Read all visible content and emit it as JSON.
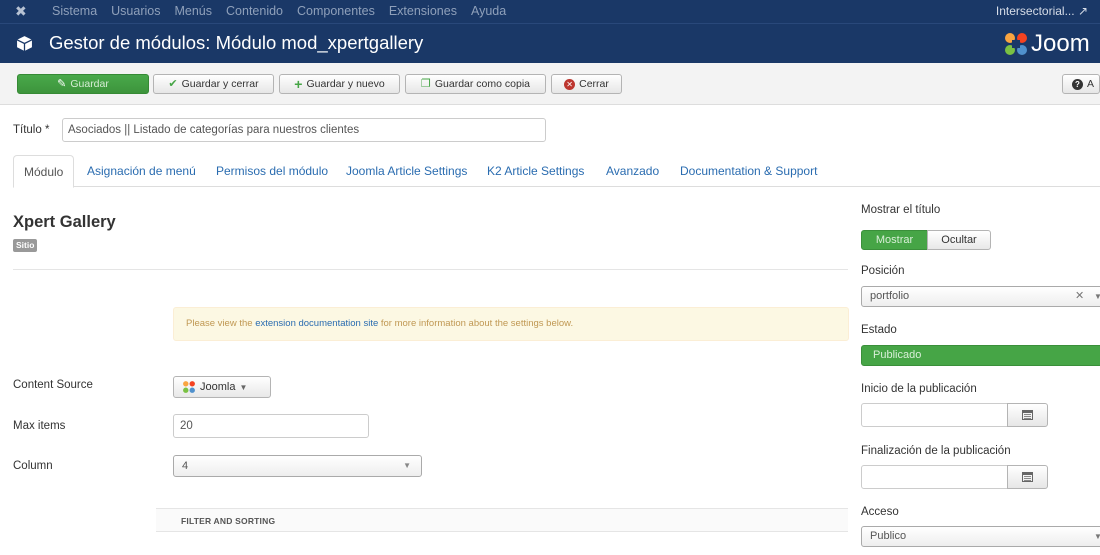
{
  "topnav": {
    "menu": [
      "Sistema",
      "Usuarios",
      "Menús",
      "Contenido",
      "Componentes",
      "Extensiones",
      "Ayuda"
    ],
    "user": "Intersectorial... ↗"
  },
  "titlebar": {
    "title": "Gestor de módulos: Módulo mod_xpertgallery",
    "brand": "Joom"
  },
  "toolbar": {
    "save": "Guardar",
    "save_close": "Guardar y cerrar",
    "save_new": "Guardar y nuevo",
    "save_copy": "Guardar como copia",
    "close": "Cerrar",
    "help": "A"
  },
  "form": {
    "title_label": "Título *",
    "title_value": "Asociados || Listado de categorías para nuestros clientes"
  },
  "tabs": [
    "Módulo",
    "Asignación de menú",
    "Permisos del módulo",
    "Joomla Article Settings",
    "K2 Article Settings",
    "Avanzado",
    "Documentation & Support"
  ],
  "module": {
    "name": "Xpert Gallery",
    "badge": "Sitio",
    "info_prefix": "Please view the ",
    "info_link": "extension documentation site",
    "info_suffix": " for more information about the settings below.",
    "content_source_label": "Content Source",
    "content_source_value": "Joomla",
    "max_items_label": "Max items",
    "max_items_value": "20",
    "column_label": "Column",
    "column_value": "4",
    "filter_heading": "FILTER AND SORTING"
  },
  "sidebar": {
    "show_title_label": "Mostrar el título",
    "show": "Mostrar",
    "hide": "Ocultar",
    "position_label": "Posición",
    "position_value": "portfolio",
    "status_label": "Estado",
    "status_value": "Publicado",
    "publish_start_label": "Inicio de la publicación",
    "publish_end_label": "Finalización de la publicación",
    "access_label": "Acceso",
    "access_value": "Publico"
  },
  "colors": {
    "nav": "#1a3867",
    "green": "#46a546",
    "link": "#2a6cb0"
  }
}
